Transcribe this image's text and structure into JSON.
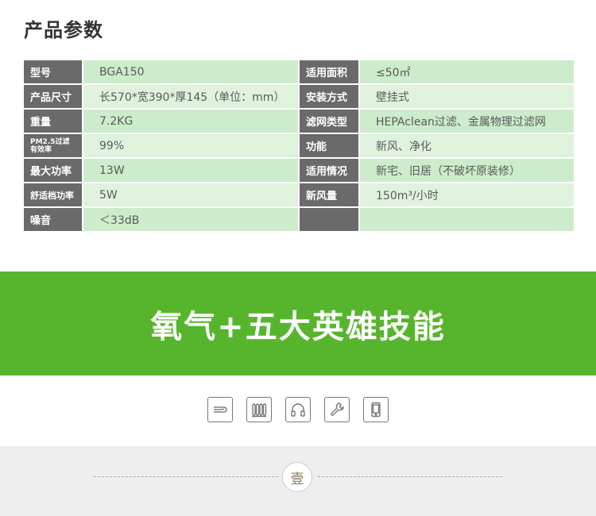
{
  "section_title": "产品参数",
  "specs": [
    {
      "label1": "型号",
      "value1": "BGA150",
      "label2": "适用面积",
      "value2": "≤50㎡"
    },
    {
      "label1": "产品尺寸",
      "value1": "长570*宽390*厚145（单位：mm）",
      "label2": "安装方式",
      "value2": "壁挂式"
    },
    {
      "label1": "重量",
      "value1": "7.2KG",
      "label2": "滤网类型",
      "value2": "HEPAclean过滤、金属物理过滤网"
    },
    {
      "label1a": "PM2.5过滤",
      "label1b": "有效率",
      "value1": "99%",
      "label2": "功能",
      "value2": "新风、净化"
    },
    {
      "label1": "最大功率",
      "value1": "13W",
      "label2": "适用情况",
      "value2": "新宅、旧居（不破坏原装修）"
    },
    {
      "label1": "舒适档功率",
      "value1": "5W",
      "label2": "新风量",
      "value2": "150m³/小时"
    },
    {
      "label1": "噪音",
      "value1": "＜33dB",
      "label2": "",
      "value2": ""
    }
  ],
  "banner": {
    "text": "氧气+五大英雄技能",
    "color": "#57b52d"
  },
  "feature_icons": [
    "airflow-icon",
    "radiator-icon",
    "headphones-icon",
    "wrench-icon",
    "phone-icon"
  ],
  "divider_badge": "壹"
}
